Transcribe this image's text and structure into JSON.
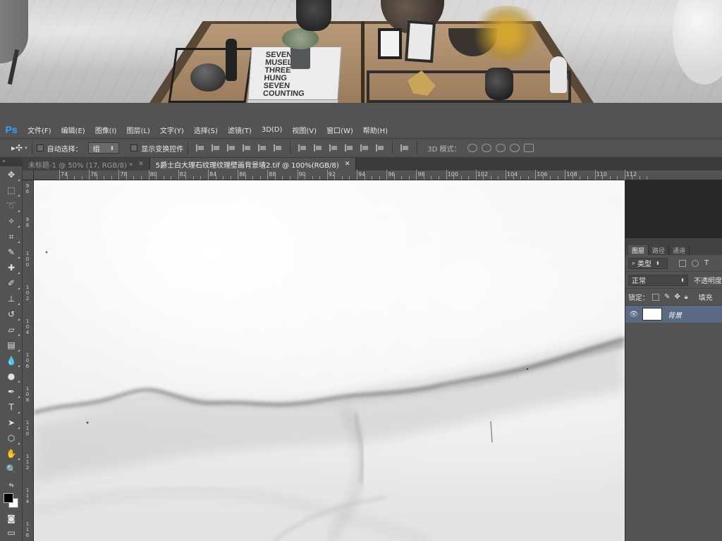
{
  "app": {
    "logo": "Ps"
  },
  "menu": [
    "文件(F)",
    "编辑(E)",
    "图像(I)",
    "图层(L)",
    "文字(Y)",
    "选择(S)",
    "滤镜(T)",
    "3D(D)",
    "视图(V)",
    "窗口(W)",
    "帮助(H)"
  ],
  "options": {
    "move_icon": "move-tool-icon",
    "auto_select_label": "自动选择：",
    "auto_select_value": "组",
    "show_transform_label": "显示变换控件",
    "mode_3d_label": "3D 模式："
  },
  "tabs": [
    {
      "title": "未标题-1 @ 50% (17, RGB/8) *",
      "active": false
    },
    {
      "title": "5爵士白大理石纹理纹理壁画背景墙2.tif @ 100%(RGB/8)",
      "active": true
    }
  ],
  "ruler_top": [
    "74",
    "76",
    "78",
    "80",
    "82",
    "84",
    "86",
    "88",
    "90",
    "92",
    "94",
    "96",
    "98",
    "100",
    "102",
    "104",
    "106",
    "108",
    "110",
    "112"
  ],
  "ruler_left": [
    "96",
    "98",
    "100",
    "102",
    "104",
    "106",
    "108",
    "110",
    "112",
    "114",
    "116"
  ],
  "photo": {
    "book_text": "SEVEN\nMUSEL\nTHREE\nHUNG\nSEVEN\nCOUNTING"
  },
  "layers_panel": {
    "tabs": [
      "图层",
      "路径",
      "通道"
    ],
    "filter_label": "类型",
    "blend_mode": "正常",
    "opacity_label": "不透明度",
    "lock_label": "锁定：",
    "fill_label": "填充",
    "layer_name": "背景"
  }
}
